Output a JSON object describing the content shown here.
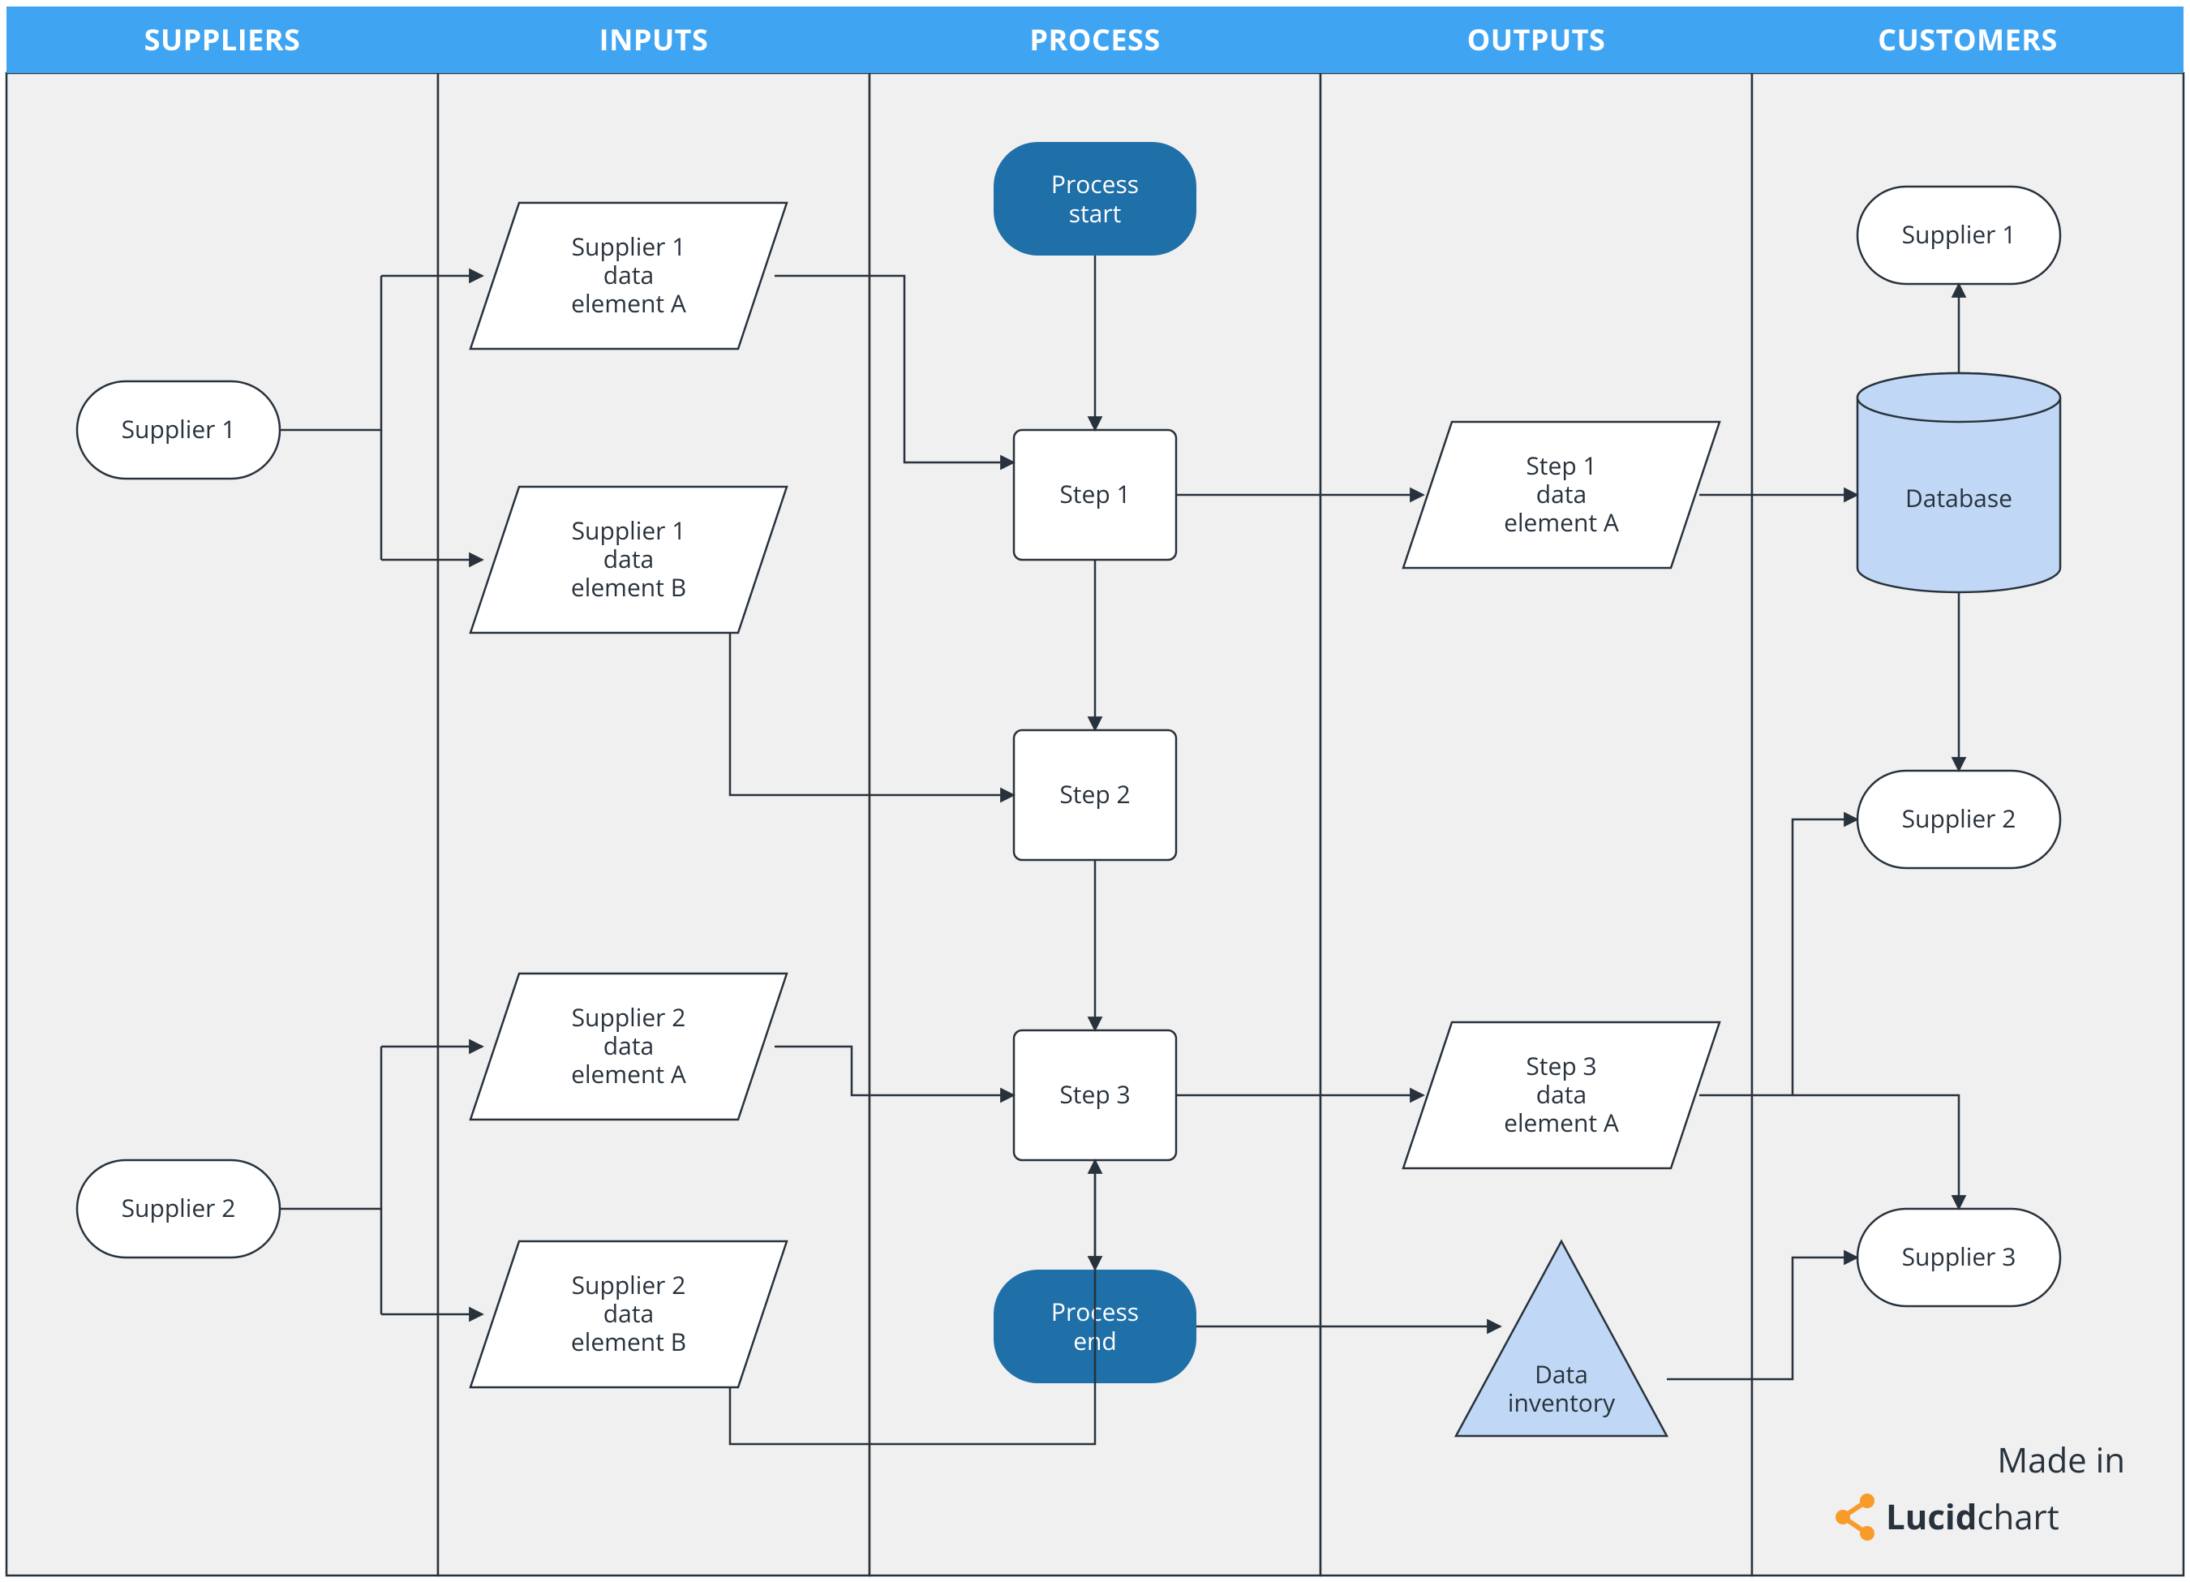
{
  "columns": [
    "SUPPLIERS",
    "INPUTS",
    "PROCESS",
    "OUTPUTS",
    "CUSTOMERS"
  ],
  "nodes": {
    "sup1": "Supplier 1",
    "sup2": "Supplier 2",
    "s1a": [
      "Supplier 1",
      "data",
      "element A"
    ],
    "s1b": [
      "Supplier 1",
      "data",
      "element B"
    ],
    "s2a": [
      "Supplier 2",
      "data",
      "element A"
    ],
    "s2b": [
      "Supplier 2",
      "data",
      "element B"
    ],
    "pstart": [
      "Process",
      "start"
    ],
    "pend": [
      "Process",
      "end"
    ],
    "step1": "Step 1",
    "step2": "Step 2",
    "step3": "Step 3",
    "out1": [
      "Step 1",
      "data",
      "element A"
    ],
    "out3": [
      "Step 3",
      "data",
      "element A"
    ],
    "inv": [
      "Data",
      "inventory"
    ],
    "cust1": "Supplier 1",
    "db": "Database",
    "cust2": "Supplier 2",
    "cust3": "Supplier 3"
  },
  "branding": {
    "made_in": "Made in",
    "brand_prefix": "Lucid",
    "brand_suffix": "chart"
  }
}
